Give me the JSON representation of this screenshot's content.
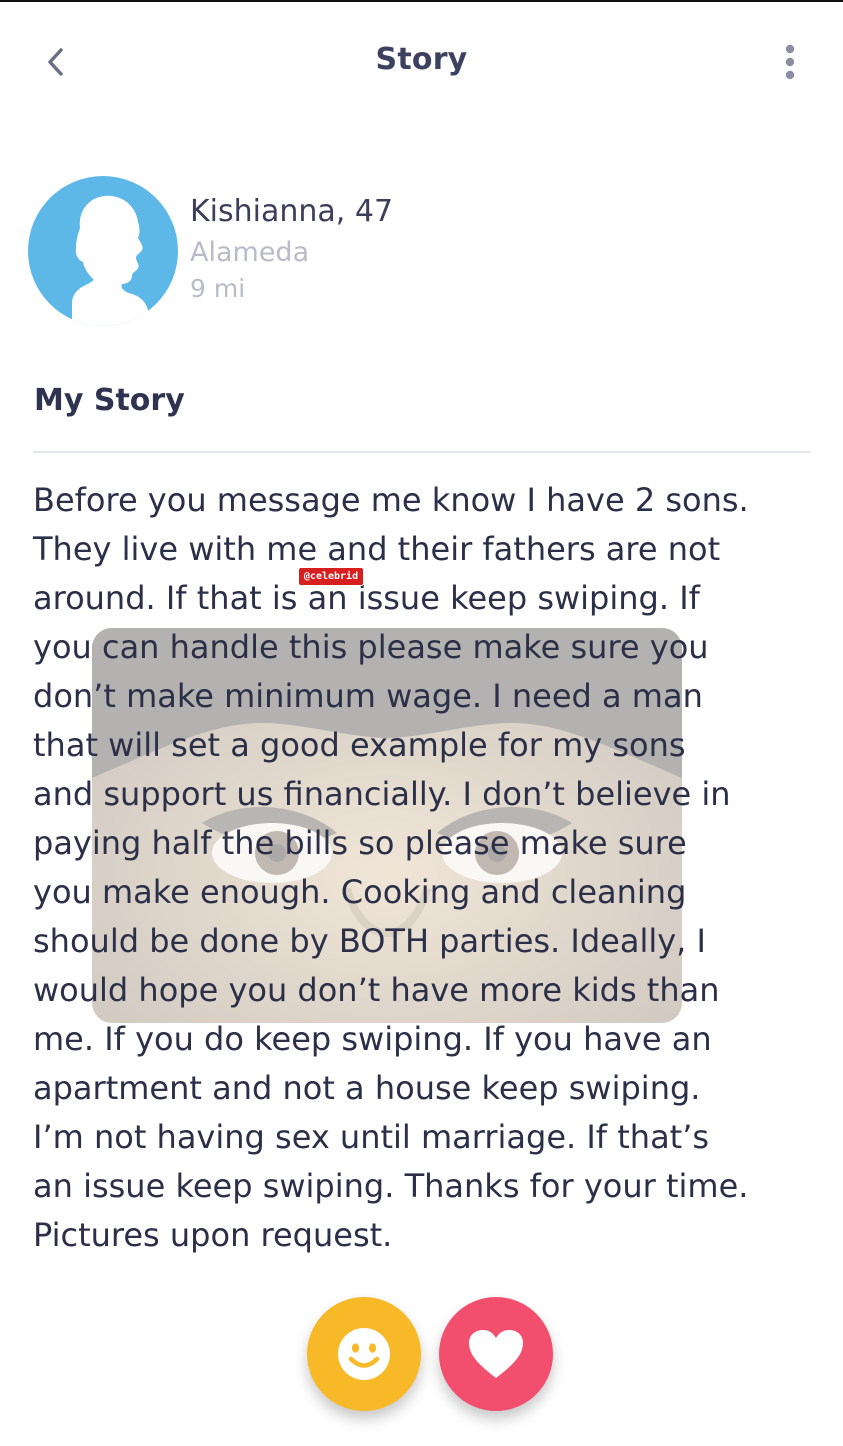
{
  "header": {
    "title": "Story",
    "back_icon": "chevron-left-icon",
    "more_icon": "vertical-dots-icon"
  },
  "profile": {
    "name_age": "Kishianna, 47",
    "city": "Alameda",
    "distance": "9 mi",
    "avatar_icon": "silhouette-avatar-icon"
  },
  "story": {
    "section_title": "My Story",
    "lines": [
      "Before you message me know I have 2 sons.",
      "They live with me and their fathers are not",
      "around. If that is an issue keep swiping. If",
      "you can handle this please make sure you",
      "don’t make minimum wage. I need a man",
      "that will set a good example for my sons",
      "and support us financially. I don’t believe in",
      "paying half the bills so please make sure",
      "you make enough. Cooking and cleaning",
      "should be done by BOTH parties. Ideally, I",
      "would hope you don’t have more kids than",
      "me. If you do keep swiping. If you have an",
      "apartment and not a house keep swiping.",
      "I’m not having sex until marriage. If that’s",
      "an issue keep swiping. Thanks for your time.",
      "Pictures upon request."
    ]
  },
  "watermark": {
    "badge_text": "@celebrid"
  },
  "actions": {
    "smile_icon": "smiley-face-icon",
    "like_icon": "heart-icon"
  },
  "colors": {
    "avatar_bg": "#5db8e8",
    "smile_button": "#f8b928",
    "like_button": "#f24f6e",
    "text_primary": "#2b2f47",
    "text_muted": "#b9bcc8"
  }
}
